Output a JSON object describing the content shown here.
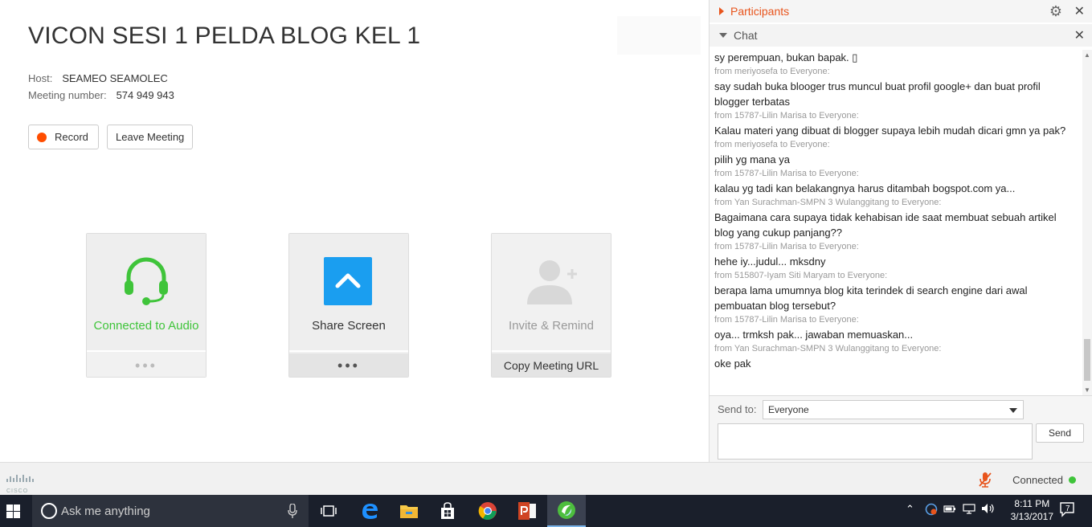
{
  "meeting": {
    "title": "VICON SESI 1 PELDA BLOG KEL 1",
    "host_label": "Host:",
    "host_value": "SEAMEO SEAMOLEC",
    "number_label": "Meeting number:",
    "number_value": "574 949 943",
    "record_label": "Record",
    "leave_label": "Leave Meeting"
  },
  "tiles": {
    "audio_label": "Connected to Audio",
    "share_label": "Share Screen",
    "invite_label": "Invite & Remind",
    "copy_url_label": "Copy Meeting URL",
    "dots": "•••"
  },
  "colors": {
    "accent_orange": "#e8541c",
    "audio_green": "#3fc43a",
    "share_blue": "#1a9ef0"
  },
  "panels": {
    "participants_title": "Participants",
    "chat_title": "Chat"
  },
  "chat": {
    "messages": [
      {
        "text": "sy perempuan, bukan bapak. ▯",
        "from": "from meriyosefa to Everyone:"
      },
      {
        "text": "say sudah buka blooger trus muncul buat profil google+ dan buat profil blogger terbatas",
        "from": "from 15787-Lilin Marisa to Everyone:"
      },
      {
        "text": "Kalau materi yang dibuat di blogger supaya lebih mudah dicari gmn ya pak?",
        "from": "from meriyosefa to Everyone:"
      },
      {
        "text": "pilih yg mana ya",
        "from": "from 15787-Lilin Marisa to Everyone:"
      },
      {
        "text": "kalau yg tadi kan belakangnya harus ditambah bogspot.com ya...",
        "from": "from Yan Surachman-SMPN 3 Wulanggitang to Everyone:"
      },
      {
        "text": "Bagaimana cara supaya tidak kehabisan ide saat membuat sebuah artikel blog yang cukup panjang??",
        "from": "from 15787-Lilin Marisa to Everyone:"
      },
      {
        "text": "hehe iy...judul... mksdny",
        "from": "from 515807-Iyam Siti Maryam to Everyone:"
      },
      {
        "text": "berapa lama umumnya blog kita terindek di search engine dari awal pembuatan blog tersebut?",
        "from": "from 15787-Lilin Marisa to Everyone:"
      },
      {
        "text": "oya... trmksh pak... jawaban memuaskan...",
        "from": "from Yan Surachman-SMPN 3 Wulanggitang to Everyone:"
      },
      {
        "text": "oke pak",
        "from": ""
      }
    ],
    "send_to_label": "Send to:",
    "send_to_value": "Everyone",
    "send_label": "Send"
  },
  "status": {
    "brand": "CISCO",
    "connection": "Connected"
  },
  "taskbar": {
    "search_placeholder": "Ask me anything",
    "time": "8:11 PM",
    "date": "3/13/2017",
    "notification_count": "7"
  }
}
